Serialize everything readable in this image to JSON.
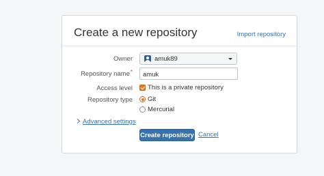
{
  "dialog": {
    "title": "Create a new repository",
    "import_link": "Import repository"
  },
  "form": {
    "owner": {
      "label": "Owner",
      "value": "amuk89"
    },
    "repository_name": {
      "label": "Repository name",
      "required_mark": "*",
      "value": "amuk"
    },
    "access_level": {
      "label": "Access level",
      "option": "This is a private repository",
      "checked": true
    },
    "repository_type": {
      "label": "Repository type",
      "options": [
        {
          "label": "Git",
          "selected": true
        },
        {
          "label": "Mercurial",
          "selected": false
        }
      ]
    },
    "advanced_settings": "Advanced settings"
  },
  "actions": {
    "create": "Create repository",
    "cancel": "Cancel"
  },
  "colors": {
    "accent": "#3572b0",
    "checkbox": "#e07b2a",
    "required": "#d04437"
  }
}
